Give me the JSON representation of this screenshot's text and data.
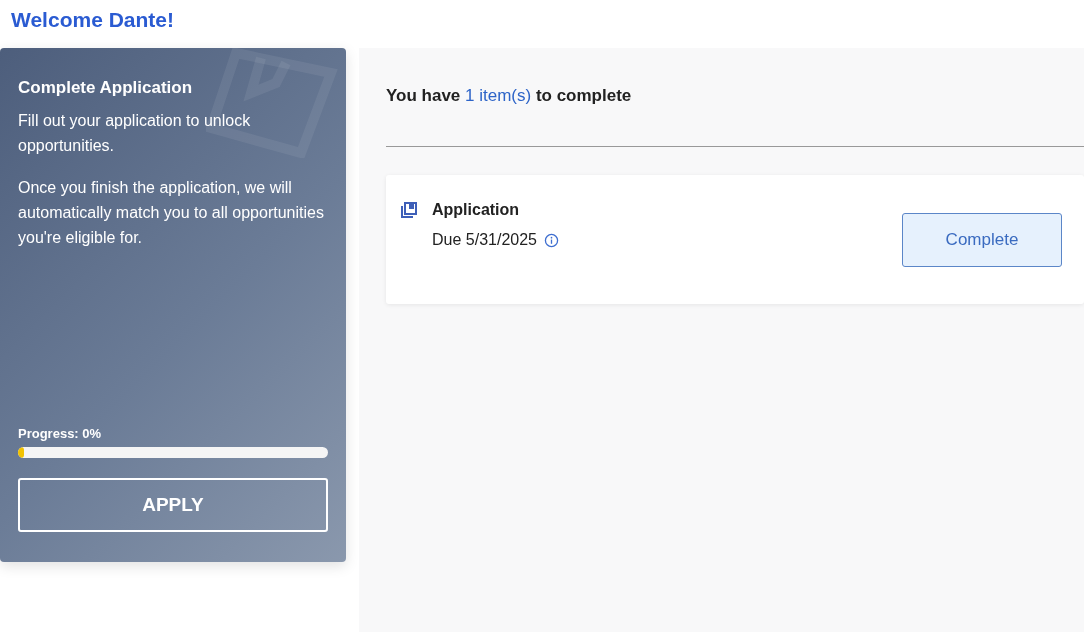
{
  "greeting": "Welcome Dante!",
  "promo_card": {
    "title": "Complete Application",
    "paragraphs": [
      "Fill out your application to unlock opportunities.",
      "Once you finish the application, we will automatically match you to all opportunities you're eligible for."
    ],
    "progress_label": "Progress: 0%",
    "progress": {
      "level": 0.02
    },
    "button": "APPLY"
  },
  "tasks": {
    "summary": {
      "before": "You have",
      "count": "1 item(s)",
      "after": "to complete"
    },
    "items": [
      {
        "title": "Application",
        "due": "Due 5/31/2025",
        "button": "Complete"
      }
    ]
  }
}
